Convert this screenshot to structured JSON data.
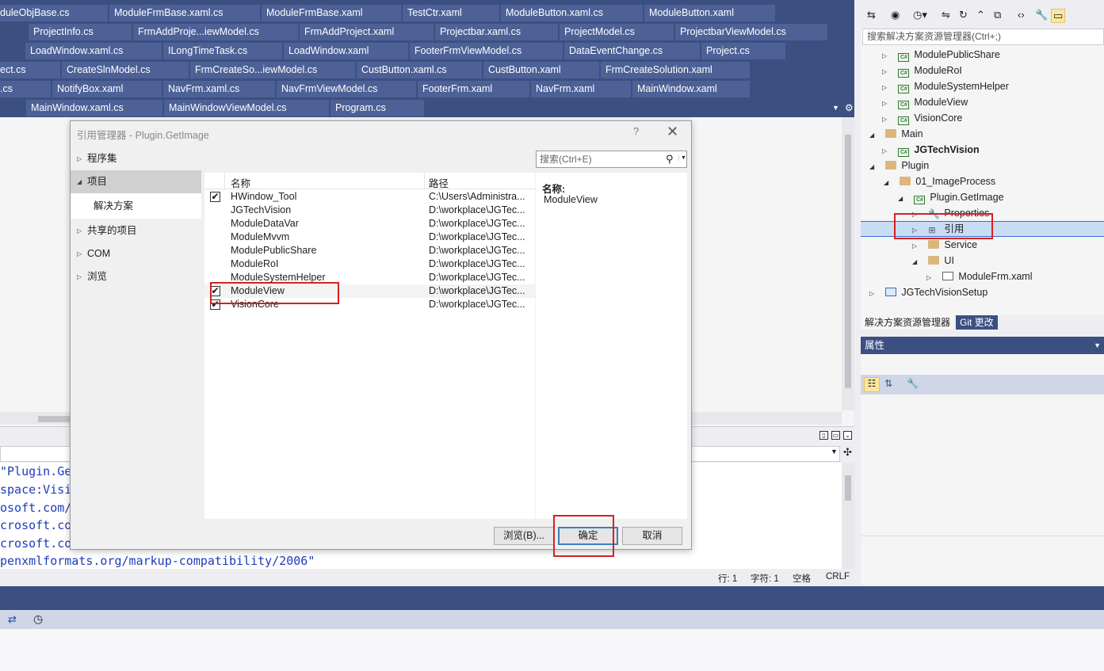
{
  "editor_tabs": {
    "row1": [
      "duleObjBase.cs",
      "ModuleFrmBase.xaml.cs",
      "ModuleFrmBase.xaml",
      "TestCtr.xaml",
      "ModuleButton.xaml.cs",
      "ModuleButton.xaml"
    ],
    "row2": [
      "ProjectInfo.cs",
      "FrmAddProje...iewModel.cs",
      "FrmAddProject.xaml",
      "Projectbar.xaml.cs",
      "ProjectModel.cs",
      "ProjectbarViewModel.cs"
    ],
    "row3": [
      "LoadWindow.xaml.cs",
      "ILongTimeTask.cs",
      "LoadWindow.xaml",
      "FooterFrmViewModel.cs",
      "DataEventChange.cs",
      "Project.cs"
    ],
    "row4": [
      "ect.cs",
      "CreateSlnModel.cs",
      "FrmCreateSo...iewModel.cs",
      "CustButton.xaml.cs",
      "CustButton.xaml",
      "FrmCreateSolution.xaml"
    ],
    "row5": [
      ".cs",
      "NotifyBox.xaml",
      "NavFrm.xaml.cs",
      "NavFrmViewModel.cs",
      "FooterFrm.xaml",
      "NavFrm.xaml",
      "MainWindow.xaml"
    ],
    "row6": [
      "MainWindow.xaml.cs",
      "MainWindowViewModel.cs",
      "Program.cs"
    ]
  },
  "code_lines": [
    "\"Plugin.Get",
    "space:Visio",
    "osoft.com/w",
    "crosoft.com",
    "crosoft.com",
    "penxmlformats.org/markup-compatibility/2006\""
  ],
  "status": {
    "line": "行: 1",
    "char": "字符: 1",
    "space": "空格",
    "eol": "CRLF"
  },
  "solution_explorer": {
    "search_placeholder": "搜索解决方案资源管理器(Ctrl+;)",
    "nodes": [
      {
        "label": "ModulePublicShare",
        "icon": "csharp-project-icon"
      },
      {
        "label": "ModuleRoI",
        "icon": "csharp-project-icon"
      },
      {
        "label": "ModuleSystemHelper",
        "icon": "csharp-project-icon"
      },
      {
        "label": "ModuleView",
        "icon": "csharp-project-icon"
      },
      {
        "label": "VisionCore",
        "icon": "csharp-project-icon"
      },
      {
        "label": "Main",
        "icon": "folder-icon"
      },
      {
        "label": "JGTechVision",
        "icon": "csharp-project-icon"
      },
      {
        "label": "Plugin",
        "icon": "folder-icon"
      },
      {
        "label": "01_ImageProcess",
        "icon": "folder-icon"
      },
      {
        "label": "Plugin.GetImage",
        "icon": "csharp-project-icon"
      },
      {
        "label": "Properties",
        "icon": "wrench-icon"
      },
      {
        "label": "引用",
        "icon": "references-icon"
      },
      {
        "label": "Service",
        "icon": "folder-icon"
      },
      {
        "label": "UI",
        "icon": "folder-icon"
      },
      {
        "label": "ModuleFrm.xaml",
        "icon": "xaml-file-icon"
      },
      {
        "label": "JGTechVisionSetup",
        "icon": "setup-project-icon"
      }
    ],
    "tab_active": "解决方案资源管理器",
    "tab_other": "Git 更改"
  },
  "properties": {
    "title": "属性"
  },
  "dialog": {
    "title": "引用管理器 - Plugin.GetImage",
    "help": "?",
    "categories": {
      "assemblies": "程序集",
      "projects": "项目",
      "solution": "解决方案",
      "shared": "共享的项目",
      "com": "COM",
      "browse": "浏览"
    },
    "search_placeholder": "搜索(Ctrl+E)",
    "col_name": "名称",
    "col_path": "路径",
    "rows": [
      {
        "name": "HWindow_Tool",
        "path": "C:\\Users\\Administra...",
        "checked": true
      },
      {
        "name": "JGTechVision",
        "path": "D:\\workplace\\JGTec...",
        "checked": false
      },
      {
        "name": "ModuleDataVar",
        "path": "D:\\workplace\\JGTec...",
        "checked": false
      },
      {
        "name": "ModuleMvvm",
        "path": "D:\\workplace\\JGTec...",
        "checked": false
      },
      {
        "name": "ModulePublicShare",
        "path": "D:\\workplace\\JGTec...",
        "checked": false
      },
      {
        "name": "ModuleRoI",
        "path": "D:\\workplace\\JGTec...",
        "checked": false
      },
      {
        "name": "ModuleSystemHelper",
        "path": "D:\\workplace\\JGTec...",
        "checked": false
      },
      {
        "name": "ModuleView",
        "path": "D:\\workplace\\JGTec...",
        "checked": true
      },
      {
        "name": "VisionCore",
        "path": "D:\\workplace\\JGTec...",
        "checked": true
      }
    ],
    "detail_label": "名称:",
    "detail_value": "ModuleView",
    "btn_browse": "浏览(B)...",
    "btn_ok": "确定",
    "btn_cancel": "取消"
  },
  "colors": {
    "tab_band": "#3b4f81",
    "tab": "#4d6197",
    "annotation": "#d62020"
  }
}
